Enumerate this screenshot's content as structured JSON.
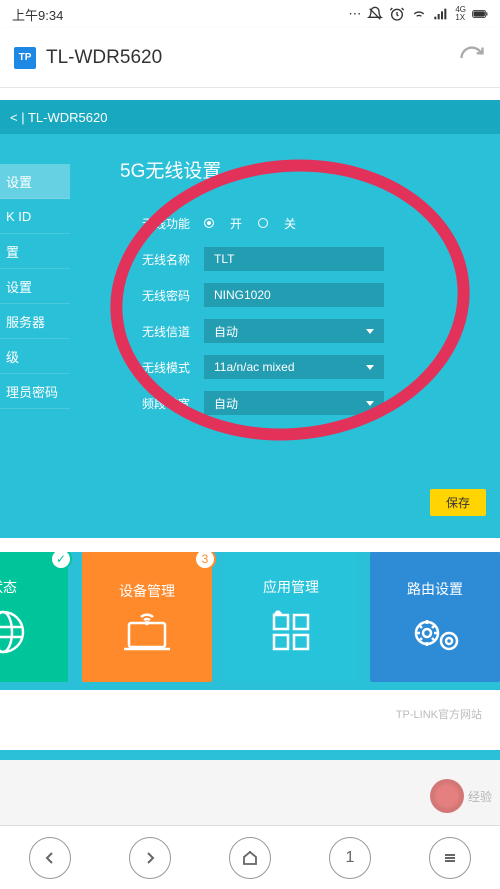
{
  "status": {
    "time": "上午9:34",
    "network_label": "4G",
    "network_sub": "1X"
  },
  "address": {
    "badge": "TP",
    "text": "TL-WDR5620"
  },
  "header": {
    "breadcrumb": "< | TL-WDR5620"
  },
  "sidebar": {
    "items": [
      {
        "label": "设置"
      },
      {
        "label": "K ID"
      },
      {
        "label": "置"
      },
      {
        "label": "设置"
      },
      {
        "label": "服务器"
      },
      {
        "label": "级"
      },
      {
        "label": "理员密码"
      }
    ],
    "active_index": 0
  },
  "panel": {
    "title": "5G无线设置",
    "rows": {
      "wireless_enable_label": "无线功能",
      "radio_on": "开",
      "radio_off": "关",
      "ssid_label": "无线名称",
      "ssid_value": "TLT",
      "pwd_label": "无线密码",
      "pwd_value": "NING1020",
      "channel_label": "无线信道",
      "channel_value": "自动",
      "mode_label": "无线模式",
      "mode_value": "11a/n/ac mixed",
      "bw_label": "频段带宽",
      "bw_value": "自动"
    },
    "save": "保存"
  },
  "tiles": [
    {
      "title": "状态",
      "color": "green",
      "badge": "✓",
      "badge_color": "#00c49a"
    },
    {
      "title": "设备管理",
      "color": "orange",
      "badge": "3",
      "badge_color": "#ff8a2b"
    },
    {
      "title": "应用管理",
      "color": "teal"
    },
    {
      "title": "路由设置",
      "color": "blue"
    }
  ],
  "footer": "TP-LINK官方网站",
  "watermark": "经验",
  "bottom_nav": {
    "tab_count": "1"
  }
}
